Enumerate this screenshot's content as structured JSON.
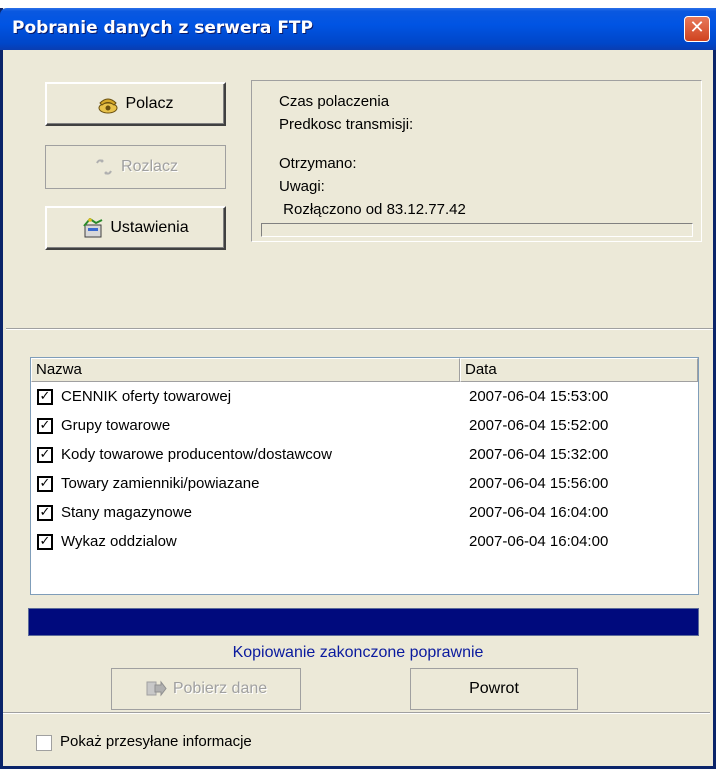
{
  "window": {
    "title": "Pobranie danych z serwera FTP",
    "close_glyph": "✕"
  },
  "buttons": {
    "connect": {
      "label": "Polacz",
      "icon": "phone-icon"
    },
    "disconnect": {
      "label": "Rozlacz",
      "icon": "disconnect-icon"
    },
    "settings": {
      "label": "Ustawienia",
      "icon": "settings-icon"
    },
    "download": {
      "label": "Pobierz dane",
      "icon": "download-icon"
    },
    "back": {
      "label": "Powrot"
    }
  },
  "info": {
    "connection_time": "Czas polaczenia",
    "transfer_speed": "Predkosc transmisji:",
    "received": "Otrzymano:",
    "notes": "Uwagi:",
    "message": " Rozłączono od 83.12.77.42"
  },
  "list": {
    "columns": [
      "Nazwa",
      "Data"
    ],
    "rows": [
      {
        "checked": true,
        "name": "CENNIK oferty towarowej",
        "date": "2007-06-04 15:53:00"
      },
      {
        "checked": true,
        "name": "Grupy towarowe",
        "date": "2007-06-04 15:52:00"
      },
      {
        "checked": true,
        "name": "Kody towarowe producentow/dostawcow",
        "date": "2007-06-04 15:32:00"
      },
      {
        "checked": true,
        "name": "Towary zamienniki/powiazane",
        "date": "2007-06-04 15:56:00"
      },
      {
        "checked": true,
        "name": "Stany magazynowe",
        "date": "2007-06-04 16:04:00"
      },
      {
        "checked": true,
        "name": "Wykaz oddzialow",
        "date": "2007-06-04 16:04:00"
      }
    ]
  },
  "progress": {
    "value": 1.0,
    "color": "#000a7d"
  },
  "status": "Kopiowanie zakonczone poprawnie",
  "footer": {
    "show_info_label": "Pokaż przesyłane informacje",
    "checked": false
  }
}
